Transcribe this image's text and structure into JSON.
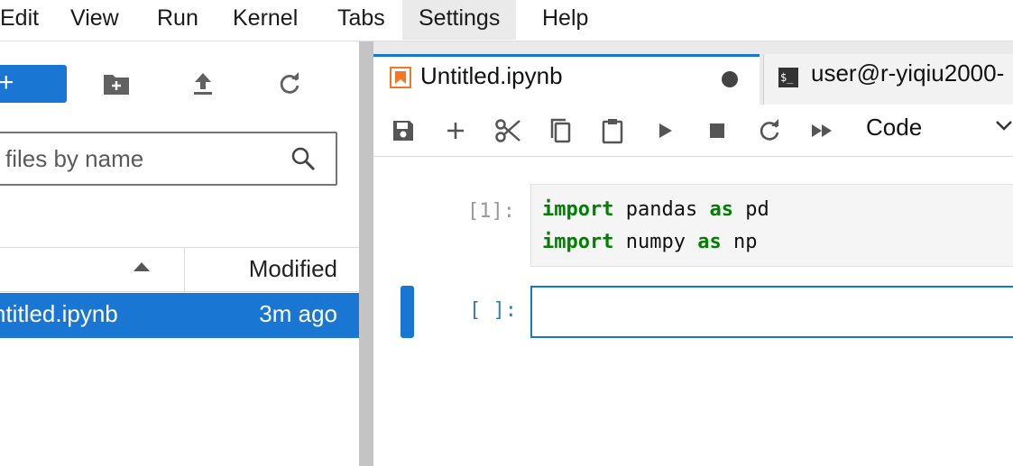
{
  "menubar": {
    "items": [
      "Edit",
      "View",
      "Run",
      "Kernel",
      "Tabs",
      "Settings",
      "Help"
    ]
  },
  "filebrowser": {
    "new_label": "+",
    "filter_placeholder": "files by name",
    "column_modified": "Modified",
    "files": [
      {
        "name": "ntitled.ipynb",
        "modified": "3m ago"
      }
    ]
  },
  "tabs": [
    {
      "label": "Untitled.ipynb",
      "icon": "notebook-icon"
    },
    {
      "label": "user@r-yiqiu2000-",
      "icon": "terminal-icon"
    }
  ],
  "toolbar": {
    "kernel_cell_type": "Code"
  },
  "cells": [
    {
      "prompt": "[1]:",
      "lines": [
        {
          "kw1": "import",
          "mid": " pandas ",
          "kw2": "as",
          "end": " pd"
        },
        {
          "kw1": "import",
          "mid": " numpy ",
          "kw2": "as",
          "end": " np"
        }
      ]
    },
    {
      "prompt": "[ ]:"
    }
  ],
  "colors": {
    "accent": "#1976d2",
    "keyword": "#008000",
    "notebook_orange": "#f37726"
  }
}
